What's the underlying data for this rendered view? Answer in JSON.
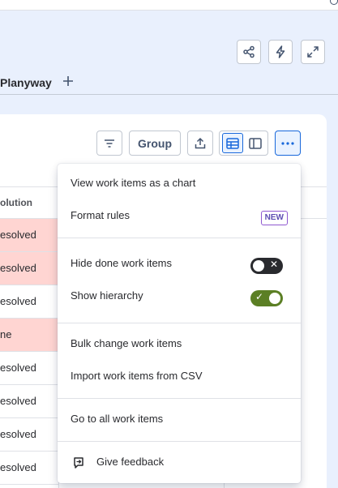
{
  "tabs": {
    "current": "Planyway"
  },
  "toolbar": {
    "group_label": "Group"
  },
  "table": {
    "column_header": "olution",
    "rows": [
      {
        "text": "esolved",
        "highlight": true
      },
      {
        "text": "esolved",
        "highlight": true
      },
      {
        "text": "esolved",
        "highlight": false
      },
      {
        "text": "ne",
        "highlight": true
      },
      {
        "text": "esolved",
        "highlight": false
      },
      {
        "text": "esolved",
        "highlight": false
      },
      {
        "text": "esolved",
        "highlight": false
      },
      {
        "text": "esolved",
        "highlight": false
      }
    ]
  },
  "menu": {
    "view_chart": "View work items as a chart",
    "format_rules": "Format rules",
    "format_rules_badge": "NEW",
    "hide_done": "Hide done work items",
    "hide_done_state": "off",
    "show_hierarchy": "Show hierarchy",
    "show_hierarchy_state": "on",
    "bulk_change": "Bulk change work items",
    "import_csv": "Import work items from CSV",
    "go_all": "Go to all work items",
    "feedback": "Give feedback"
  },
  "icons": {
    "share": "share-icon",
    "automation": "lightning-icon",
    "fullscreen": "expand-icon",
    "add_tab": "plus-icon",
    "filter": "filter-icon",
    "export": "export-icon",
    "list_view": "table-view-icon",
    "detail_view": "detail-view-icon",
    "more": "more-icon",
    "feedback": "feedback-icon"
  },
  "colors": {
    "accent": "#1868db",
    "header_bg": "#e9f0fd",
    "highlight_row": "#ffd5d2",
    "toggle_on": "#5b7f24",
    "toggle_off": "#292a2e",
    "badge": "#8f58d0"
  }
}
